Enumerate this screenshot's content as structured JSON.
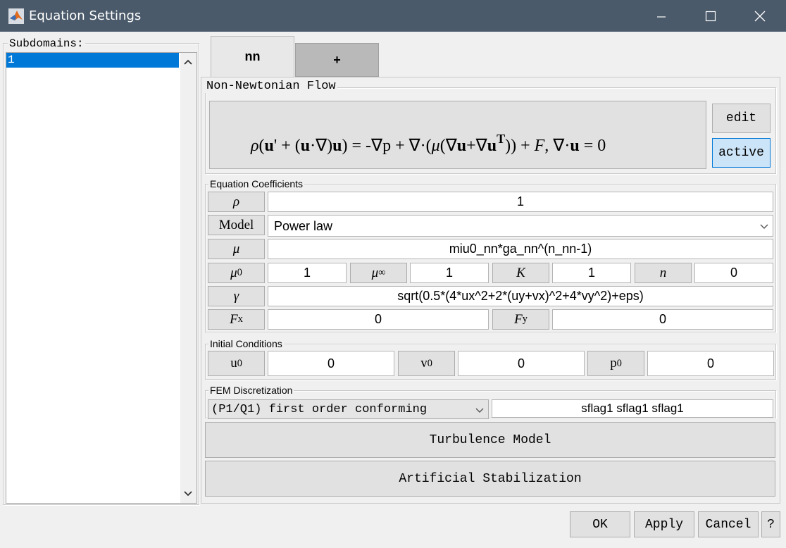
{
  "window": {
    "title": "Equation Settings"
  },
  "subdomains": {
    "label": "Subdomains:",
    "items": [
      "1"
    ]
  },
  "tabs": [
    {
      "label": "nn"
    },
    {
      "label": "+"
    }
  ],
  "flow": {
    "title": "Non-Newtonian Flow",
    "equation": "ρ(u' + (u·∇)u) = -∇p + ∇·(μ(∇u+∇uT)) + F, ∇·u = 0",
    "edit_label": "edit",
    "active_label": "active"
  },
  "coefficients": {
    "title": "Equation Coefficients",
    "rho_label": "ρ",
    "rho_value": "1",
    "model_label": "Model",
    "model_value": "Power law",
    "mu_label": "μ",
    "mu_value": "miu0_nn*ga_nn^(n_nn-1)",
    "mu0_label": "μ",
    "mu0_sub": "0",
    "mu0_value": "1",
    "muinf_label": "μ",
    "muinf_sub": "∞",
    "muinf_value": "1",
    "k_label": "K",
    "k_value": "1",
    "n_label": "n",
    "n_value": "0",
    "gamma_label": "γ",
    "gamma_value": "sqrt(0.5*(4*ux^2+2*(uy+vx)^2+4*vy^2)+eps)",
    "fx_label": "F",
    "fx_sub": "x",
    "fx_value": "0",
    "fy_label": "F",
    "fy_sub": "y",
    "fy_value": "0"
  },
  "initial": {
    "title": "Initial Conditions",
    "u0_label": "u",
    "u0_sub": "0",
    "u0_value": "0",
    "v0_label": "v",
    "v0_sub": "0",
    "v0_value": "0",
    "p0_label": "p",
    "p0_sub": "0",
    "p0_value": "0"
  },
  "fem": {
    "title": "FEM Discretization",
    "selected": "(P1/Q1) first order conforming",
    "flags": "sflag1 sflag1 sflag1"
  },
  "turbulence_label": "Turbulence Model",
  "stabilization_label": "Artificial Stabilization",
  "footer": {
    "ok": "OK",
    "apply": "Apply",
    "cancel": "Cancel",
    "help": "?"
  },
  "colors": {
    "titlebar": "#4a5a6a",
    "selection": "#0078d7",
    "active_bg": "#cce4f7",
    "active_border": "#0078d7"
  }
}
